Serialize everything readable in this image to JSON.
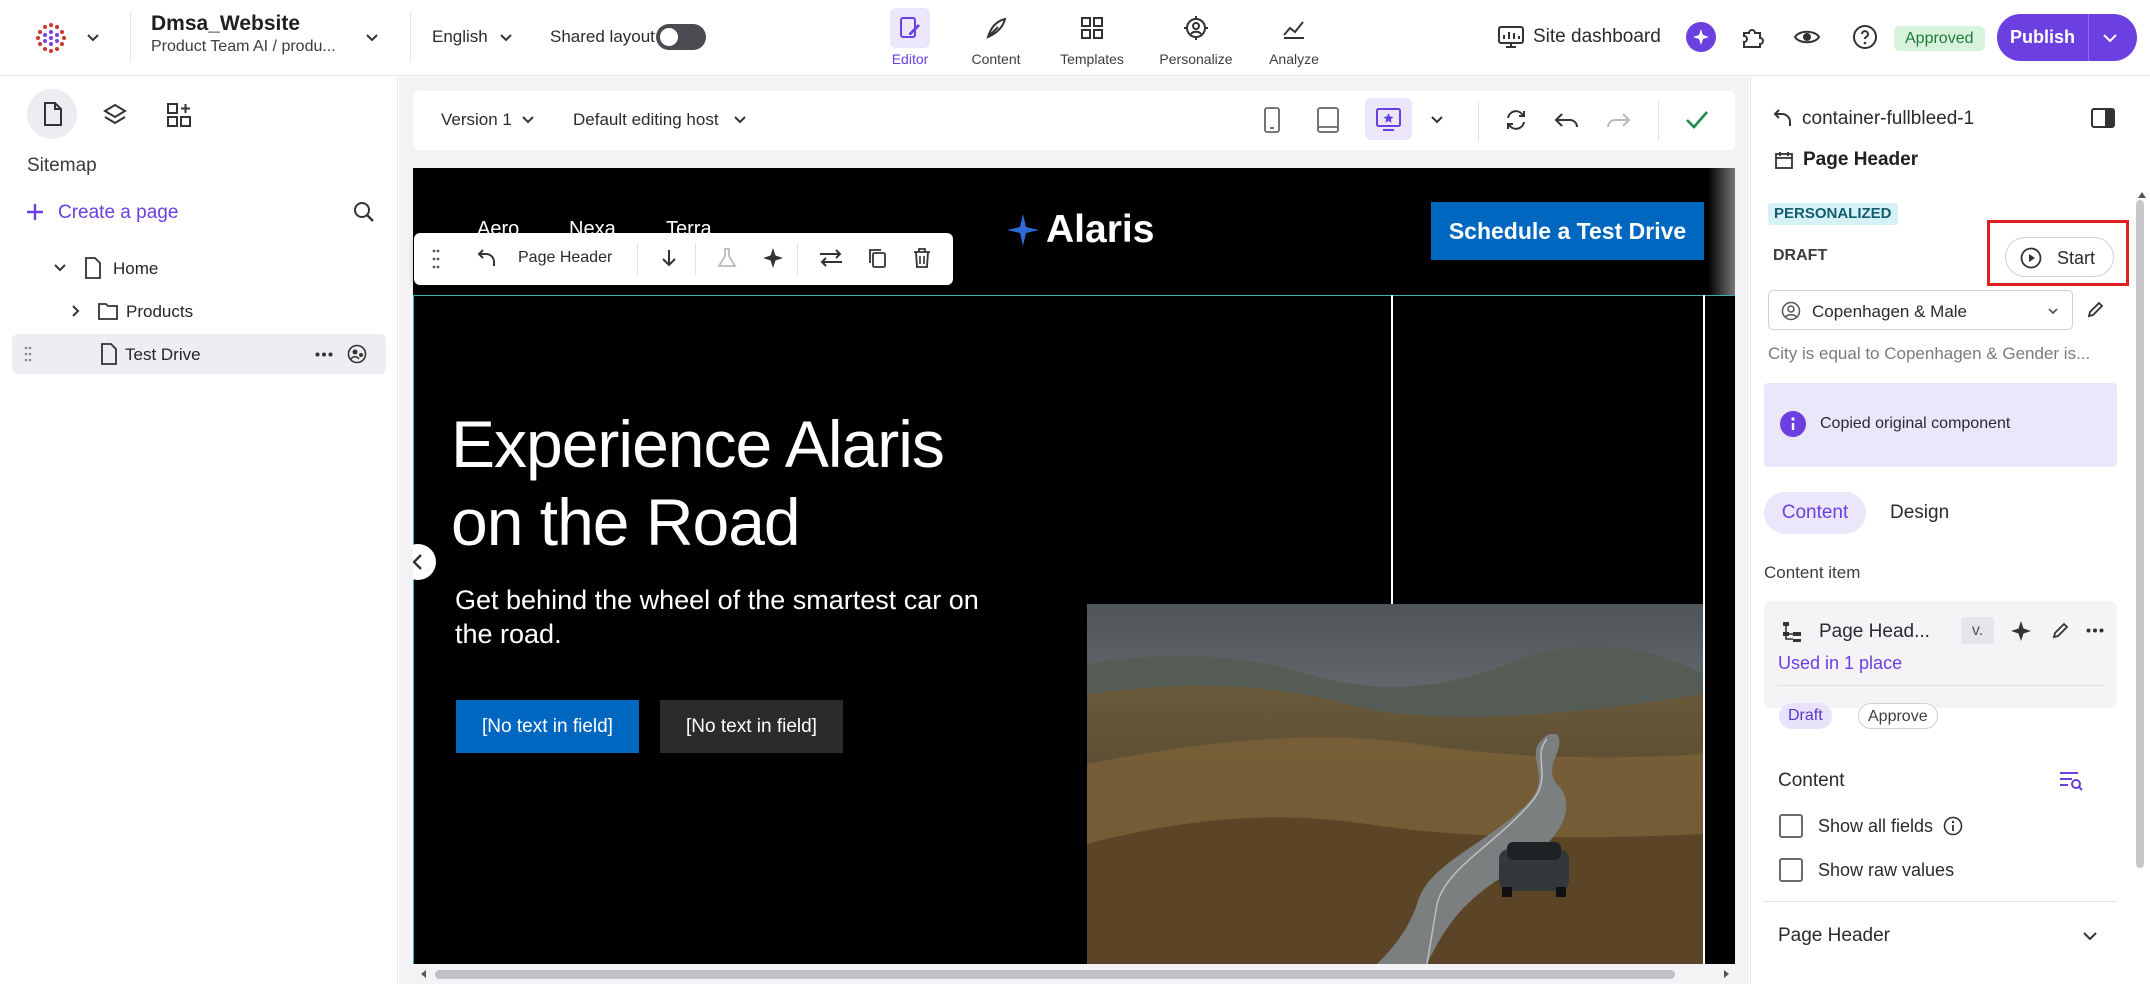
{
  "topbar": {
    "site_name": "Dmsa_Website",
    "site_path": "Product Team AI / produ...",
    "language": "English",
    "shared_layout_label": "Shared layout",
    "nav": [
      {
        "label": "Editor",
        "icon": "editor-icon",
        "active": true
      },
      {
        "label": "Content",
        "icon": "feather-icon"
      },
      {
        "label": "Templates",
        "icon": "templates-icon"
      },
      {
        "label": "Personalize",
        "icon": "personalize-icon"
      },
      {
        "label": "Analyze",
        "icon": "analyze-icon"
      }
    ],
    "site_dashboard": "Site dashboard",
    "status_badge": "Approved",
    "publish": "Publish",
    "colors": {
      "accent": "#6b3fe0",
      "approved_bg": "#d8f3dc"
    }
  },
  "sidebar": {
    "section_title": "Sitemap",
    "create_page": "Create a page",
    "tree": [
      {
        "label": "Home",
        "icon": "page-icon",
        "expanded": true
      },
      {
        "label": "Products",
        "icon": "folder-icon"
      },
      {
        "label": "Test Drive",
        "icon": "page-icon",
        "selected": true
      }
    ]
  },
  "canvas_toolbar": {
    "version": "Version 1",
    "editing_host": "Default editing host"
  },
  "component_toolbar": {
    "component_name": "Page Header"
  },
  "preview": {
    "nav_links": [
      "Aero",
      "Nexa",
      "Terra"
    ],
    "logo_text": "Alaris",
    "cta": "Schedule a Test Drive",
    "hero_title_line1": "Experience Alaris",
    "hero_title_line2": "on the Road",
    "hero_subtitle": "Get behind the wheel of the smartest car on the road.",
    "button_primary": "[No text in field]",
    "button_secondary": "[No text in field]",
    "colors": {
      "brand_blue": "#0067c0"
    }
  },
  "right_panel": {
    "parent": "container-fullbleed-1",
    "component_title": "Page Header",
    "personalized_badge": "PERSONALIZED",
    "draft_label": "DRAFT",
    "start_button": "Start",
    "variant_select": "Copenhagen & Male",
    "condition": "City is equal to Copenhagen & Gender is...",
    "info_message": "Copied original component",
    "tabs": [
      "Content",
      "Design"
    ],
    "content_item_label": "Content item",
    "content_item_name": "Page Head...",
    "version_chip": "v.",
    "used_in": "Used in 1 place",
    "draft_chip": "Draft",
    "approve_chip": "Approve",
    "content_heading": "Content",
    "show_all_fields": "Show all fields",
    "show_raw_values": "Show raw values",
    "section_page_header": "Page Header"
  }
}
